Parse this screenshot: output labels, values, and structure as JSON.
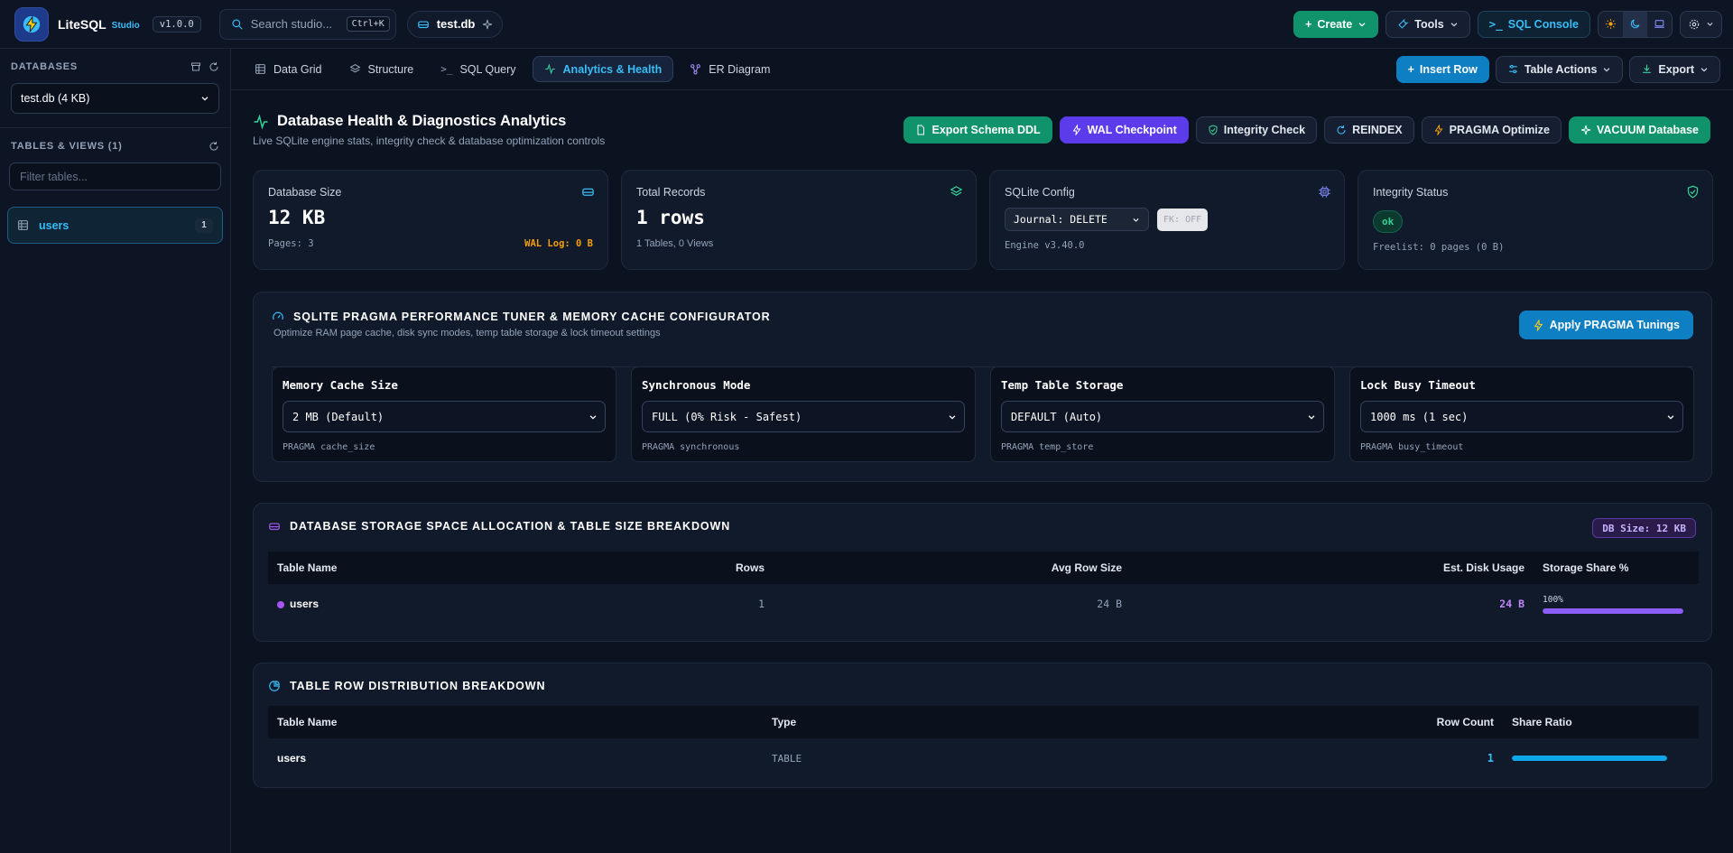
{
  "app": {
    "name": "LiteSQL",
    "sub": "Studio",
    "version": "v1.0.0",
    "search_placeholder": "Search studio...",
    "search_shortcut": "Ctrl+K",
    "db_chip": "test.db",
    "buttons": {
      "create": "Create",
      "tools": "Tools",
      "sql_console": "SQL Console"
    }
  },
  "sidebar": {
    "databases_heading": "DATABASES",
    "db_select": "test.db (4 KB)",
    "tables_heading": "TABLES & VIEWS (1)",
    "filter_placeholder": "Filter tables...",
    "items": [
      {
        "label": "users",
        "count": "1"
      }
    ]
  },
  "tabs": [
    {
      "label": "Data Grid",
      "icon": "grid-icon"
    },
    {
      "label": "Structure",
      "icon": "layers-icon"
    },
    {
      "label": "SQL Query",
      "icon": "terminal-icon"
    },
    {
      "label": "Analytics & Health",
      "icon": "pulse-icon",
      "active": true
    },
    {
      "label": "ER Diagram",
      "icon": "share-icon"
    }
  ],
  "tab_actions": {
    "insert_row": "Insert Row",
    "table_actions": "Table Actions",
    "export": "Export"
  },
  "page": {
    "title": "Database Health & Diagnostics Analytics",
    "subtitle": "Live SQLite engine stats, integrity check & database optimization controls",
    "actions": {
      "export_ddl": "Export Schema DDL",
      "wal_checkpoint": "WAL Checkpoint",
      "integrity_check": "Integrity Check",
      "reindex": "REINDEX",
      "pragma_optimize": "PRAGMA Optimize",
      "vacuum": "VACUUM Database"
    }
  },
  "stats": {
    "db_size": {
      "label": "Database Size",
      "value": "12 KB",
      "pages": "Pages: 3",
      "wal": "WAL Log: 0 B"
    },
    "records": {
      "label": "Total Records",
      "value": "1 rows",
      "foot": "1 Tables, 0 Views"
    },
    "config": {
      "label": "SQLite Config",
      "journal": "Journal: DELETE",
      "fk": "FK: OFF",
      "engine": "Engine v3.40.0"
    },
    "integrity": {
      "label": "Integrity Status",
      "status": "ok",
      "freelist": "Freelist: 0 pages (0 B)"
    }
  },
  "tuner": {
    "title": "SQLITE PRAGMA PERFORMANCE TUNER & MEMORY CACHE CONFIGURATOR",
    "subtitle": "Optimize RAM page cache, disk sync modes, temp table storage & lock timeout settings",
    "apply": "Apply PRAGMA Tunings",
    "settings": [
      {
        "label": "Memory Cache Size",
        "value": "2 MB (Default)",
        "hint": "PRAGMA cache_size"
      },
      {
        "label": "Synchronous Mode",
        "value": "FULL (0% Risk - Safest)",
        "hint": "PRAGMA synchronous"
      },
      {
        "label": "Temp Table Storage",
        "value": "DEFAULT (Auto)",
        "hint": "PRAGMA temp_store"
      },
      {
        "label": "Lock Busy Timeout",
        "value": "1000 ms (1 sec)",
        "hint": "PRAGMA busy_timeout"
      }
    ]
  },
  "storage": {
    "title": "DATABASE STORAGE SPACE ALLOCATION & TABLE SIZE BREAKDOWN",
    "db_size_chip": "DB Size: 12 KB",
    "headers": [
      "Table Name",
      "Rows",
      "Avg Row Size",
      "Est. Disk Usage",
      "Storage Share %"
    ],
    "rows": [
      {
        "name": "users",
        "rows": "1",
        "avg": "24 B",
        "disk": "24 B",
        "share_label": "100%",
        "share": 1.0
      }
    ]
  },
  "distribution": {
    "title": "TABLE ROW DISTRIBUTION BREAKDOWN",
    "headers": [
      "Table Name",
      "Type",
      "Row Count",
      "Share Ratio"
    ],
    "rows": [
      {
        "name": "users",
        "type": "TABLE",
        "count": "1",
        "share": 1.0
      }
    ]
  },
  "colors": {
    "accent": "#38bdf8",
    "green": "#10936a",
    "violet": "#5b3bea",
    "purple": "#a855f7",
    "orange": "#f59e0b"
  }
}
